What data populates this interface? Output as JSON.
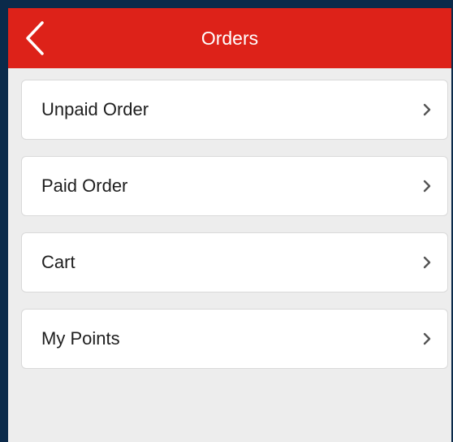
{
  "header": {
    "title": "Orders",
    "back_icon": "chevron-left-icon",
    "background_color": "#dd2219"
  },
  "menu": {
    "items": [
      {
        "label": "Unpaid Order",
        "icon": "chevron-right-icon"
      },
      {
        "label": "Paid Order",
        "icon": "chevron-right-icon"
      },
      {
        "label": "Cart",
        "icon": "chevron-right-icon"
      },
      {
        "label": "My Points",
        "icon": "chevron-right-icon"
      }
    ]
  }
}
